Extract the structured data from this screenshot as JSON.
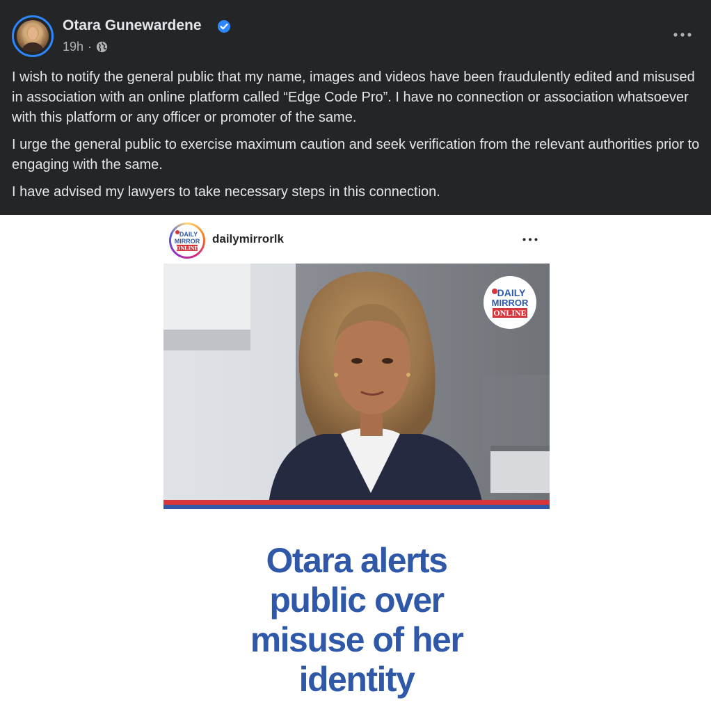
{
  "post": {
    "author": "Otara Gunewardene",
    "timestamp": "19h",
    "separator": "·",
    "audience_icon": "globe-icon",
    "verified_icon": "verified-badge-icon",
    "paragraphs": [
      "I wish to notify the general public that my name, images and videos have been fraudulently edited and misused in association with an online platform called “Edge Code Pro”. I have no connection or association whatsoever with this platform or any officer or promoter of the same.",
      "I urge the general public to exercise maximum caution and seek verification from the relevant authorities prior to engaging with the same.",
      "I have advised my lawyers to take necessary steps in this connection."
    ]
  },
  "embed": {
    "username": "dailymirrorlk",
    "logo": {
      "line1": "DAILY",
      "line2": "MIRROR",
      "line3": "ONLINE"
    },
    "headline_lines": [
      "Otara alerts",
      "public over",
      "misuse of her",
      "identity"
    ]
  },
  "colors": {
    "fb_bg": "#242526",
    "fb_text": "#e4e6eb",
    "fb_muted": "#b0b3b8",
    "verified": "#2d88ff",
    "headline": "#2f58a8",
    "stripe_red": "#d6353b",
    "stripe_blue": "#2f58a8"
  }
}
